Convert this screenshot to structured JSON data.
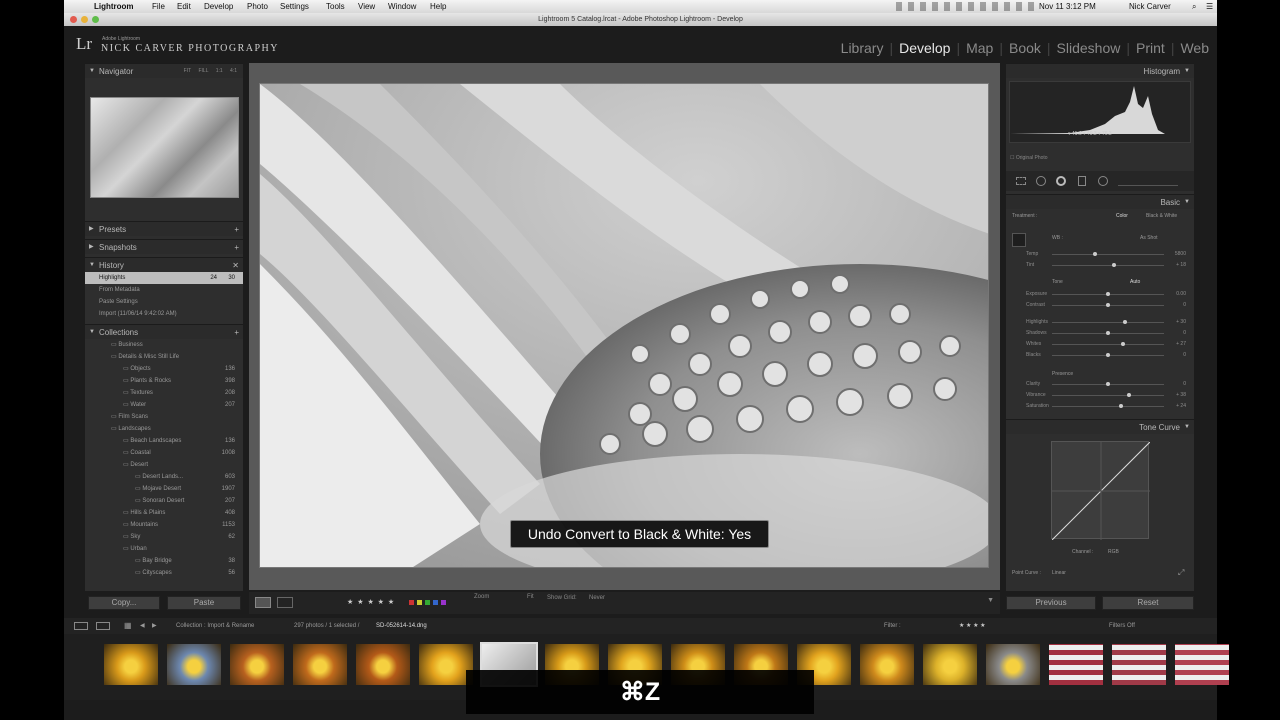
{
  "menubar": {
    "app": "Lightroom",
    "items": [
      "File",
      "Edit",
      "Develop",
      "Photo",
      "Settings",
      "Tools",
      "View",
      "Window",
      "Help"
    ],
    "clock": "Nov 11  3:12 PM",
    "user": "Nick Carver"
  },
  "window": {
    "title": "Lightroom 5 Catalog.lrcat - Adobe Photoshop Lightroom - Develop"
  },
  "identity": {
    "small": "Adobe Lightroom",
    "name": "NICK CARVER PHOTOGRAPHY"
  },
  "modules": [
    "Library",
    "Develop",
    "Map",
    "Book",
    "Slideshow",
    "Print",
    "Web"
  ],
  "active_module": "Develop",
  "left": {
    "navigator": "Navigator",
    "nav_zoom": [
      "FIT",
      "FILL",
      "1:1",
      "4:1"
    ],
    "presets": "Presets",
    "snapshots": "Snapshots",
    "history": "History",
    "history_items": [
      {
        "label": "Highlights",
        "v1": "24",
        "v2": "30"
      },
      {
        "label": "From Metadata",
        "v1": "",
        "v2": ""
      },
      {
        "label": "Paste Settings",
        "v1": "",
        "v2": ""
      },
      {
        "label": "Import (11/06/14 9:42:02 AM)",
        "v1": "",
        "v2": ""
      }
    ],
    "collections": "Collections",
    "collection_items": [
      {
        "label": "Business",
        "cnt": ""
      },
      {
        "label": "Details & Misc Still Life",
        "cnt": ""
      },
      {
        "label": "Objects",
        "cnt": "136"
      },
      {
        "label": "Plants & Rocks",
        "cnt": "398"
      },
      {
        "label": "Textures",
        "cnt": "208"
      },
      {
        "label": "Water",
        "cnt": "207"
      },
      {
        "label": "Film Scans",
        "cnt": ""
      },
      {
        "label": "Landscapes",
        "cnt": ""
      },
      {
        "label": "Beach Landscapes",
        "cnt": "136"
      },
      {
        "label": "Coastal",
        "cnt": "1008"
      },
      {
        "label": "Desert",
        "cnt": ""
      },
      {
        "label": "Desert Lands...",
        "cnt": "603"
      },
      {
        "label": "Mojave Desert",
        "cnt": "1907"
      },
      {
        "label": "Sonoran Desert",
        "cnt": "207"
      },
      {
        "label": "Hills & Plains",
        "cnt": "408"
      },
      {
        "label": "Mountains",
        "cnt": "1153"
      },
      {
        "label": "Sky",
        "cnt": "62"
      },
      {
        "label": "Urban",
        "cnt": ""
      },
      {
        "label": "Bay Bridge",
        "cnt": "38"
      },
      {
        "label": "Cityscapes",
        "cnt": "56"
      }
    ],
    "copy_btn": "Copy...",
    "paste_btn": "Paste"
  },
  "hud": "Undo Convert to Black & White: Yes",
  "toolbar": {
    "stars": "★ ★ ★ ★ ★",
    "zoom": "Zoom",
    "fit": "Fit",
    "show_grid": "Show Grid:",
    "never": "Never"
  },
  "right": {
    "histogram": "Histogram",
    "hist_values": "▾ 41.6  ▾ 49.3  ▾ 76.3",
    "original_photo": "Original Photo",
    "basic": "Basic",
    "treatment": "Treatment :",
    "color": "Color",
    "bw": "Black & White",
    "wb": "WB :",
    "as_shot": "As Shot",
    "tone": "Tone",
    "auto": "Auto",
    "presence": "Presence",
    "tone_curve": "Tone Curve",
    "channel": "Channel :",
    "rgb": "RGB",
    "point_curve": "Point Curve :",
    "linear": "Linear",
    "previous": "Previous",
    "reset": "Reset",
    "sliders": [
      {
        "label": "Temp",
        "value": "5800",
        "pos": 0.38
      },
      {
        "label": "Tint",
        "value": "+ 18",
        "pos": 0.55
      },
      {
        "label": "Exposure",
        "value": "0.00",
        "pos": 0.5
      },
      {
        "label": "Contrast",
        "value": "0",
        "pos": 0.5
      },
      {
        "label": "Highlights",
        "value": "+ 30",
        "pos": 0.65
      },
      {
        "label": "Shadows",
        "value": "0",
        "pos": 0.5
      },
      {
        "label": "Whites",
        "value": "+ 27",
        "pos": 0.63
      },
      {
        "label": "Blacks",
        "value": "0",
        "pos": 0.5
      },
      {
        "label": "Clarity",
        "value": "0",
        "pos": 0.5
      },
      {
        "label": "Vibrance",
        "value": "+ 38",
        "pos": 0.69
      },
      {
        "label": "Saturation",
        "value": "+ 24",
        "pos": 0.62
      }
    ]
  },
  "filmbar": {
    "collection": "Collection : Import & Rename",
    "count": "297 photos / 1 selected /",
    "file": "SD-052614-14.dng",
    "filter": "Filter :",
    "filters_off": "Filters Off"
  },
  "thumb_colors": [
    "#d99a1a",
    "#6d88b0",
    "#b8611f",
    "#c06a1c",
    "#b45a18",
    "#e3a21c",
    "#9a9a9a",
    "#d79a18",
    "#e0a51e",
    "#cf8e18",
    "#bf7817",
    "#e2a31e",
    "#cf8a1c",
    "#dcb12a",
    "#8a8a8a",
    "#a23040",
    "#a03a48",
    "#b04050"
  ],
  "keystroke": "⌘Z"
}
